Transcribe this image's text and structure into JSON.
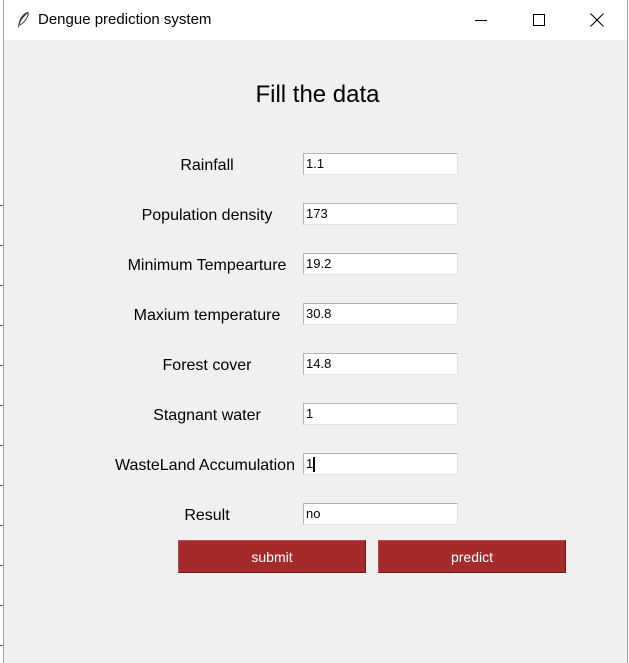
{
  "window": {
    "title": "Dengue prediction system",
    "icon": "feather-icon"
  },
  "form": {
    "heading": "Fill the data",
    "fields": [
      {
        "label": "Rainfall",
        "value": "1.1"
      },
      {
        "label": "Population density",
        "value": "173"
      },
      {
        "label": "Minimum Tempearture",
        "value": "19.2"
      },
      {
        "label": "Maxium temperature",
        "value": "30.8"
      },
      {
        "label": "Forest cover",
        "value": "14.8"
      },
      {
        "label": "Stagnant water",
        "value": "1"
      },
      {
        "label": "WasteLand Accumulation",
        "value": "1"
      },
      {
        "label": "Result",
        "value": "no"
      }
    ],
    "submit_label": "submit",
    "predict_label": "predict"
  },
  "colors": {
    "button_bg": "#a52a2a",
    "button_text": "#ffffff",
    "window_bg": "#f0f0f0"
  }
}
